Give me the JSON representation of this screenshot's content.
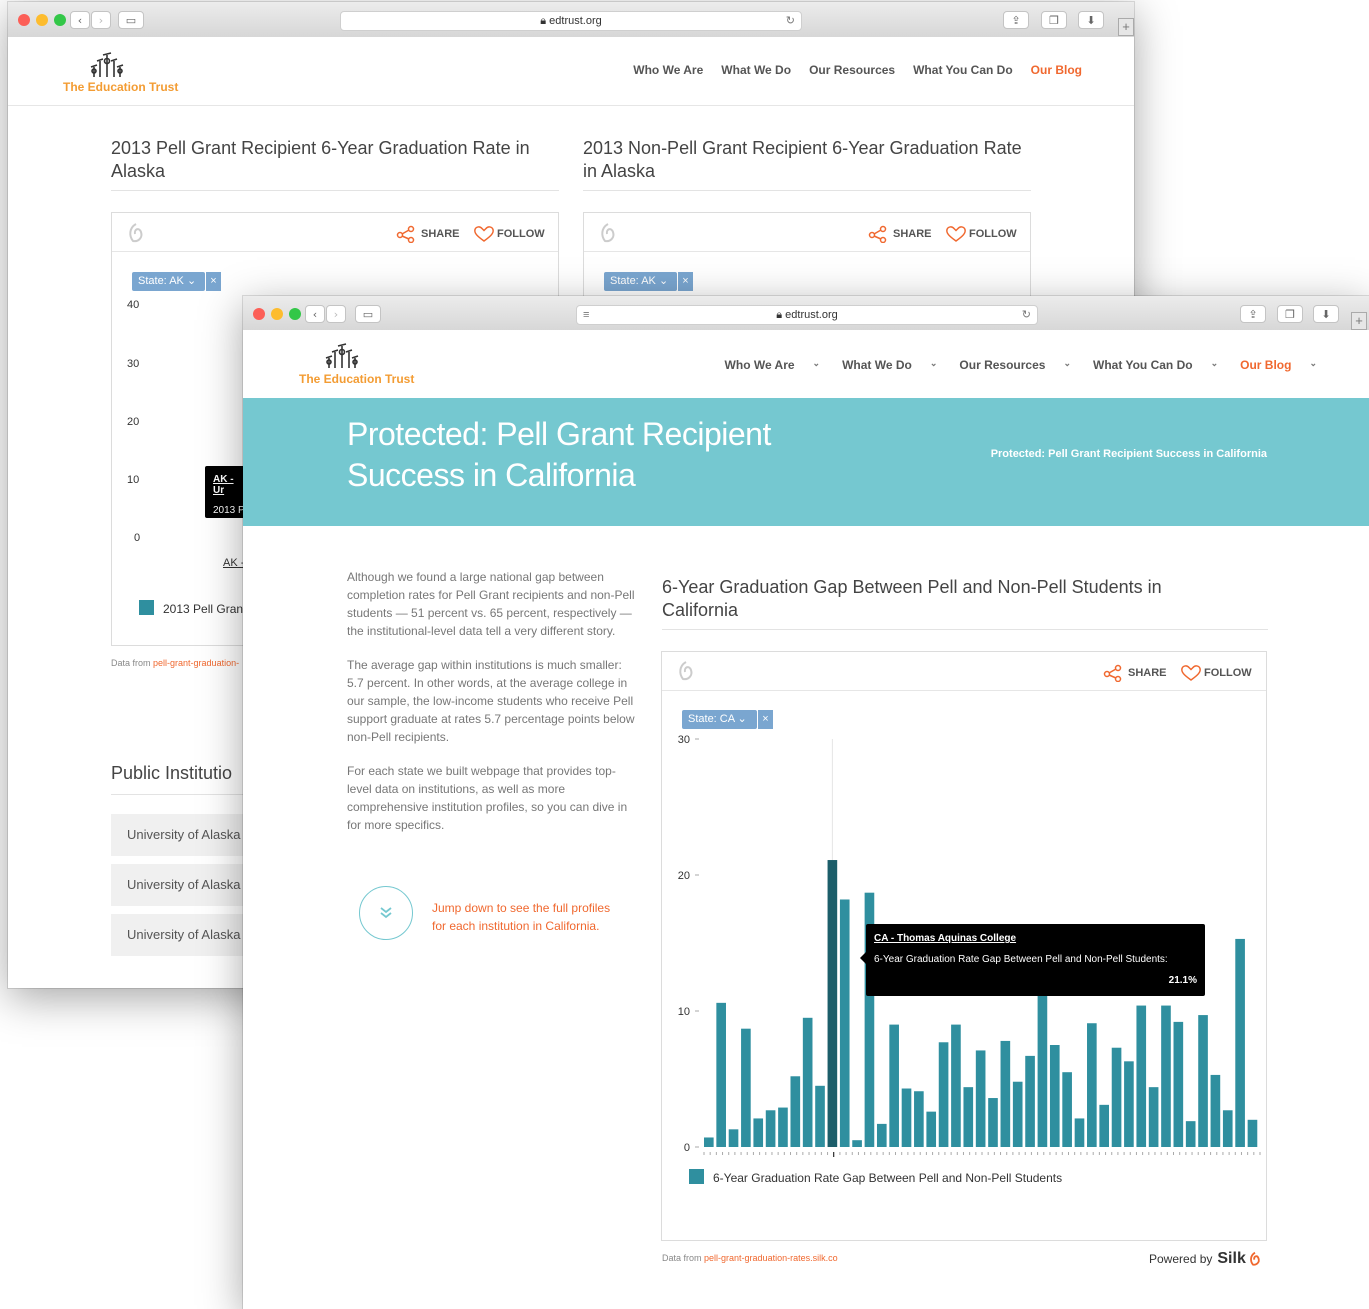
{
  "browser": {
    "url": "edtrust.org"
  },
  "site": {
    "logo_text": "The Education Trust",
    "nav": [
      "Who We Are",
      "What We Do",
      "Our Resources",
      "What You Can Do",
      "Our Blog"
    ]
  },
  "back_window": {
    "left_title": "2013 Pell Grant Recipient 6-Year Graduation Rate in Alaska",
    "right_title": "2013 Non-Pell Grant Recipient 6-Year Graduation Rate in Alaska",
    "share_label": "SHARE",
    "follow_label": "FOLLOW",
    "filter_label": "State: AK",
    "filter_close": "×",
    "tooltip_title": "AK - Ur",
    "tooltip_line": "2013 P",
    "x_label": "AK -",
    "legend": "2013 Pell Grant",
    "data_from": "Data from",
    "data_link": "pell-grant-graduation-",
    "public_title": "Public Institutio",
    "institutions": [
      "University of Alaska",
      "University of Alaska",
      "University of Alaska"
    ],
    "chart_data": {
      "type": "bar",
      "title": "2013 Pell Grant Recipient 6-Year Graduation Rate in Alaska",
      "yticks": [
        0,
        10,
        20,
        30,
        40
      ],
      "ylim": [
        0,
        40
      ]
    }
  },
  "front_window": {
    "banner_title_line1": "Protected: Pell Grant Recipient",
    "banner_title_line2": "Success in California",
    "breadcrumb": "Protected: Pell Grant Recipient Success in California",
    "paragraphs": [
      "Although we found a large national gap between completion rates for Pell Grant recipients and non-Pell students — 51 percent vs. 65 percent, respectively — the institutional-level data tell a very different story.",
      "The average gap within institutions is much smaller: 5.7 percent. In other words, at the average college in our sample, the low-income students who receive Pell support graduate at rates 5.7 percentage points below non-Pell recipients.",
      "For each state we built webpage that provides top-level data on institutions, as well as more comprehensive institution profiles, so you can dive in for more specifics."
    ],
    "jump_text": "Jump down to see the full profiles for each institution in California.",
    "chart_title": "6-Year Graduation Gap Between Pell and Non-Pell Students in California",
    "share_label": "SHARE",
    "follow_label": "FOLLOW",
    "filter_label": "State: CA",
    "filter_close": "×",
    "tooltip": {
      "title": "CA - Thomas Aquinas College",
      "label": "6-Year Graduation Rate Gap Between Pell and Non-Pell Students:",
      "value": "21.1%"
    },
    "legend": "6-Year Graduation Rate Gap Between Pell and Non-Pell Students",
    "data_from": "Data from",
    "data_link": "pell-grant-graduation-rates.silk.co",
    "powered_by": "Powered by",
    "silk": "Silk"
  },
  "chart_data": {
    "type": "bar",
    "title": "6-Year Graduation Gap Between Pell and Non-Pell Students in California",
    "ylim": [
      0,
      30
    ],
    "yticks": [
      0,
      10,
      20,
      30
    ],
    "series": [
      {
        "name": "6-Year Graduation Rate Gap Between Pell and Non-Pell Students",
        "values": [
          0.7,
          10.6,
          1.3,
          8.7,
          2.1,
          2.7,
          2.9,
          5.2,
          9.5,
          4.5,
          21.1,
          18.2,
          0.5,
          18.7,
          1.7,
          9.0,
          4.3,
          4.1,
          2.6,
          7.7,
          9.0,
          4.4,
          7.1,
          3.6,
          7.8,
          4.8,
          6.7,
          12.6,
          7.5,
          5.5,
          2.1,
          9.1,
          3.1,
          7.3,
          6.3,
          10.4,
          4.4,
          10.4,
          9.2,
          1.9,
          9.7,
          5.3,
          2.7,
          15.3,
          2.0
        ],
        "highlight_index": 10
      }
    ],
    "color": "#2f8f9f",
    "highlight_color": "#1c5e6a"
  },
  "colors": {
    "accent": "#f0682f",
    "banner": "#75c8d0",
    "bar": "#2f8f9f",
    "logo": "#f39c33"
  }
}
